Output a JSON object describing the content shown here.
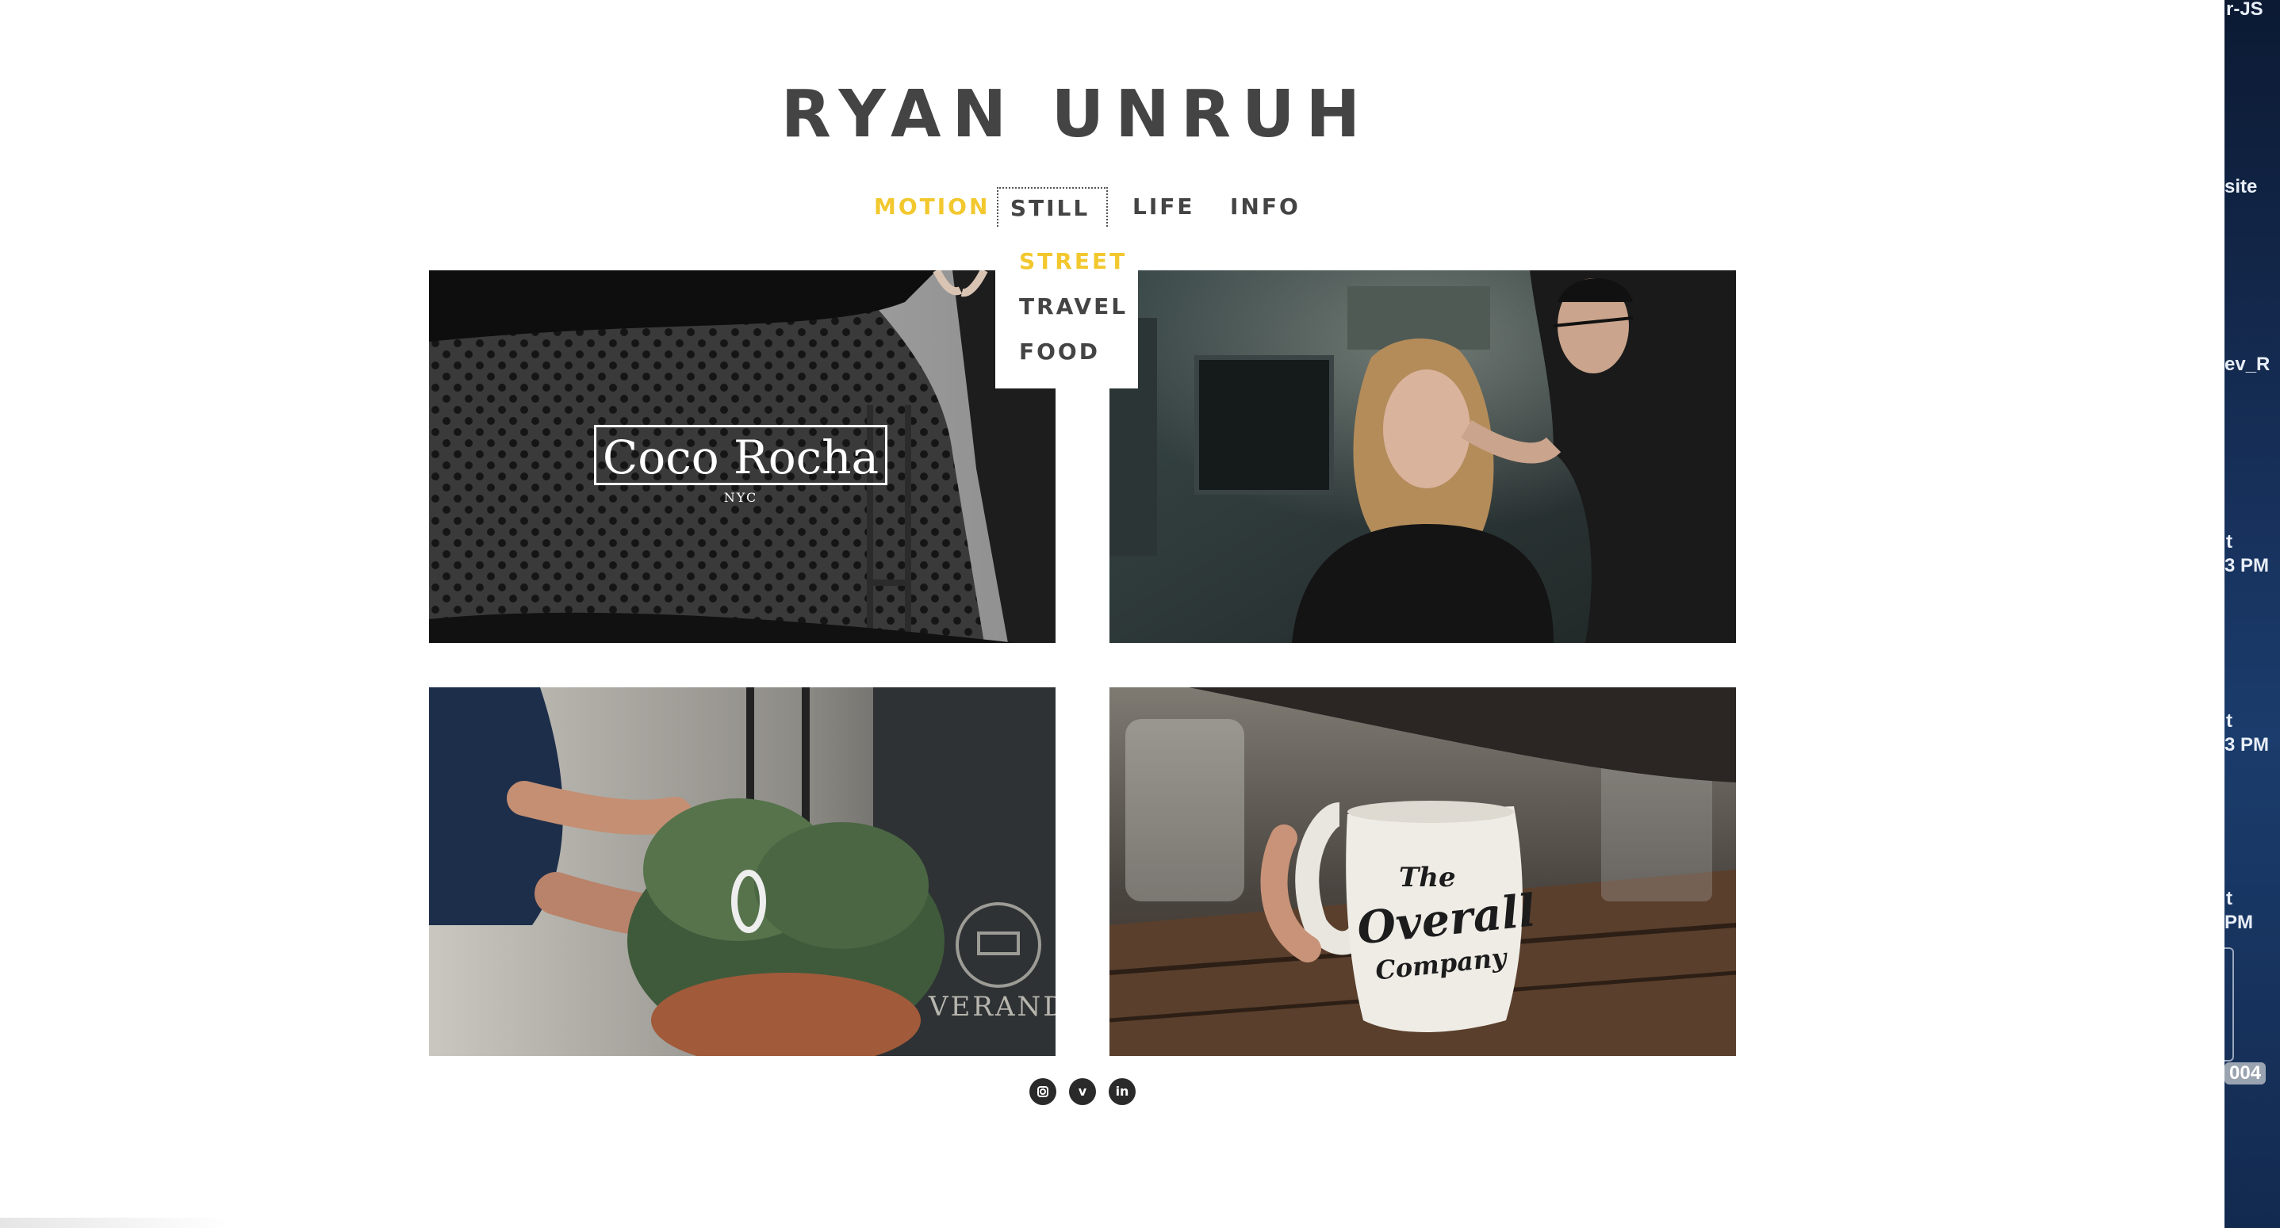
{
  "site": {
    "title": "RYAN UNRUH"
  },
  "nav": {
    "items": [
      {
        "label": "MOTION",
        "active": true
      },
      {
        "label": "STILL",
        "active": false
      },
      {
        "label": "LIFE",
        "active": false
      },
      {
        "label": "INFO",
        "active": false
      }
    ],
    "dropdown": {
      "parent": "STILL",
      "items": [
        {
          "label": "STREET",
          "active": true
        },
        {
          "label": "TRAVEL",
          "active": false
        },
        {
          "label": "FOOD",
          "active": false
        }
      ]
    }
  },
  "gallery": {
    "tiles": [
      {
        "overlay_title": "Coco Rocha",
        "overlay_subtitle": "NYC"
      },
      {
        "overlay_title": ""
      },
      {
        "overlay_title": "VERAND"
      },
      {
        "mug_lines": [
          "The",
          "Overall",
          "Company"
        ]
      }
    ]
  },
  "social": [
    {
      "icon": "instagram-icon"
    },
    {
      "icon": "vimeo-icon",
      "glyph": "v"
    },
    {
      "icon": "linkedin-icon",
      "glyph": "in"
    }
  ],
  "colors": {
    "accent": "#f2c82e",
    "text": "#444444",
    "background": "#ffffff"
  },
  "desktop": {
    "labels": [
      "r-JS",
      "site",
      "ev_R",
      "t",
      "3 PM",
      "t",
      "3 PM",
      "t",
      "PM",
      "004"
    ]
  }
}
